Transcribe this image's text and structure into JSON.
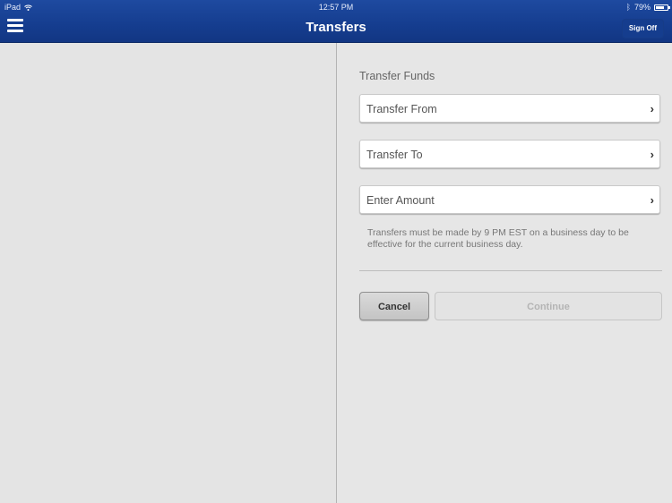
{
  "status_bar": {
    "device": "iPad",
    "time": "12:57 PM",
    "battery_percent": "79%",
    "battery_level": 0.79
  },
  "header": {
    "title": "Transfers",
    "menu_icon": "hamburger-icon",
    "sign_off_label": "Sign Off"
  },
  "form": {
    "section_title": "Transfer Funds",
    "fields": [
      {
        "label": "Transfer From",
        "icon": "chevron-right-icon"
      },
      {
        "label": "Transfer To",
        "icon": "chevron-right-icon"
      },
      {
        "label": "Enter Amount",
        "icon": "chevron-right-icon"
      }
    ],
    "note": "Transfers must be made by 9 PM EST on a business day to be effective for the current business day.",
    "cancel_label": "Cancel",
    "continue_label": "Continue",
    "continue_enabled": false
  },
  "icons": {
    "chevron": "›"
  }
}
